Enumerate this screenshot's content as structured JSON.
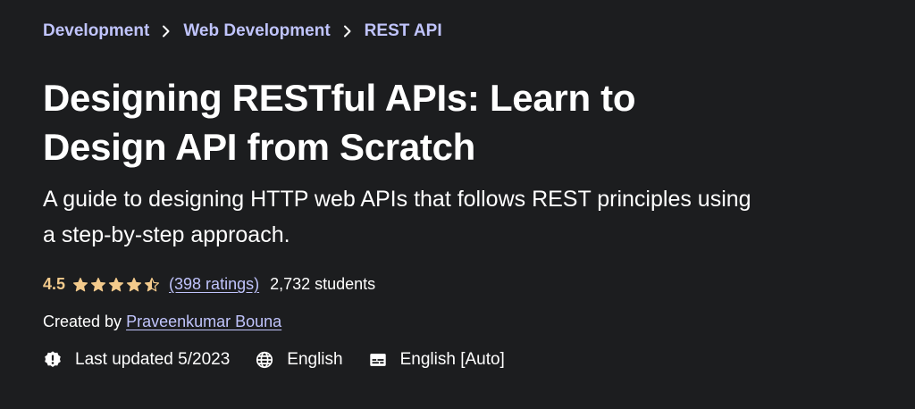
{
  "breadcrumb": {
    "items": [
      "Development",
      "Web Development",
      "REST API"
    ]
  },
  "course": {
    "title_line1": "Designing RESTful APIs: Learn to",
    "title_line2": "Design API from Scratch",
    "subtitle_line1": "A guide to designing HTTP web APIs that follows REST principles using",
    "subtitle_line2": "a step-by-step approach."
  },
  "rating": {
    "value": "4.5",
    "stars": 4.5,
    "ratings_text": "(398 ratings)",
    "students_text": "2,732 students"
  },
  "creator": {
    "prefix": "Created by",
    "name": "Praveenkumar Bouna"
  },
  "meta": {
    "last_updated": "Last updated 5/2023",
    "language": "English",
    "captions": "English [Auto]"
  },
  "icons": {
    "separator": "chevron-right-icon",
    "star": "star-icon",
    "updated": "alert-badge-icon",
    "language": "globe-icon",
    "captions": "closed-captions-icon"
  },
  "colors": {
    "background": "#1c1d1f",
    "link": "#c0c4fc",
    "rating": "#f3ca8c",
    "text": "#ffffff"
  }
}
